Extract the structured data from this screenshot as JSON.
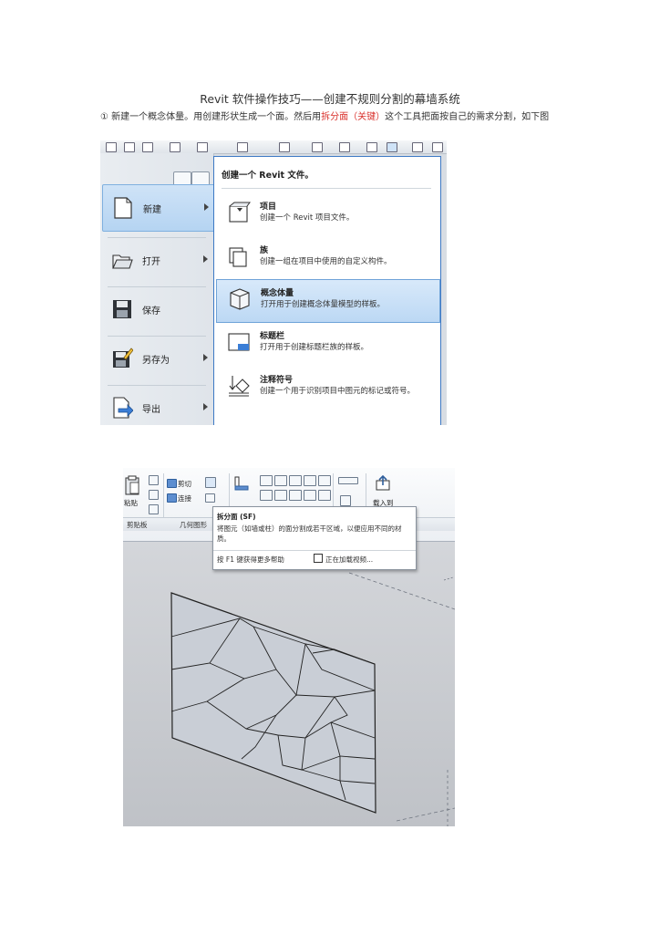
{
  "document": {
    "title": "Revit 软件操作技巧——创建不规则分割的幕墙系统",
    "step1": {
      "before": "① 新建一个概念体量。用创建形状生成一个面。然后用",
      "highlight": "拆分面（关键）",
      "after": "这个工具把面按自己的需求分割，如下图",
      "highlight_color": "#d9302b"
    }
  },
  "app_menu": {
    "items": [
      {
        "label": "新建",
        "icon": "new-document-icon",
        "selected": true
      },
      {
        "label": "打开",
        "icon": "open-folder-icon",
        "selected": false
      },
      {
        "label": "保存",
        "icon": "save-disk-icon",
        "selected": false
      },
      {
        "label": "另存为",
        "icon": "save-as-icon",
        "selected": false
      },
      {
        "label": "导出",
        "icon": "export-icon",
        "selected": false
      }
    ],
    "header": "创建一个 Revit 文件。",
    "options": [
      {
        "title": "项目",
        "desc": "创建一个 Revit 项目文件。",
        "icon": "project-icon",
        "selected": false
      },
      {
        "title": "族",
        "desc": "创建一组在项目中使用的自定义构件。",
        "icon": "family-icon",
        "selected": false
      },
      {
        "title": "概念体量",
        "desc": "打开用于创建概念体量模型的样板。",
        "icon": "conceptual-mass-icon",
        "selected": true
      },
      {
        "title": "标题栏",
        "desc": "打开用于创建标题栏族的样板。",
        "icon": "title-block-icon",
        "selected": false
      },
      {
        "title": "注释符号",
        "desc": "创建一个用于识别项目中图元的标记或符号。",
        "icon": "annotation-symbol-icon",
        "selected": false
      }
    ]
  },
  "ribbon": {
    "paste_label": "粘贴",
    "cut_label": "剪切",
    "join_label": "连接",
    "load_label": "载入到",
    "panels": [
      "剪贴板",
      "几何图形"
    ]
  },
  "tooltip": {
    "title": "拆分面 (SF)",
    "desc": "将图元（如墙或柱）的面分割成若干区域，以便应用不同的材质。",
    "f1": "按 F1 键获得更多帮助",
    "video": "正在加载视频..."
  },
  "colors": {
    "accent": "#3d79c4",
    "wall_fill": "#c9ced6",
    "wall_stroke": "#222222"
  }
}
